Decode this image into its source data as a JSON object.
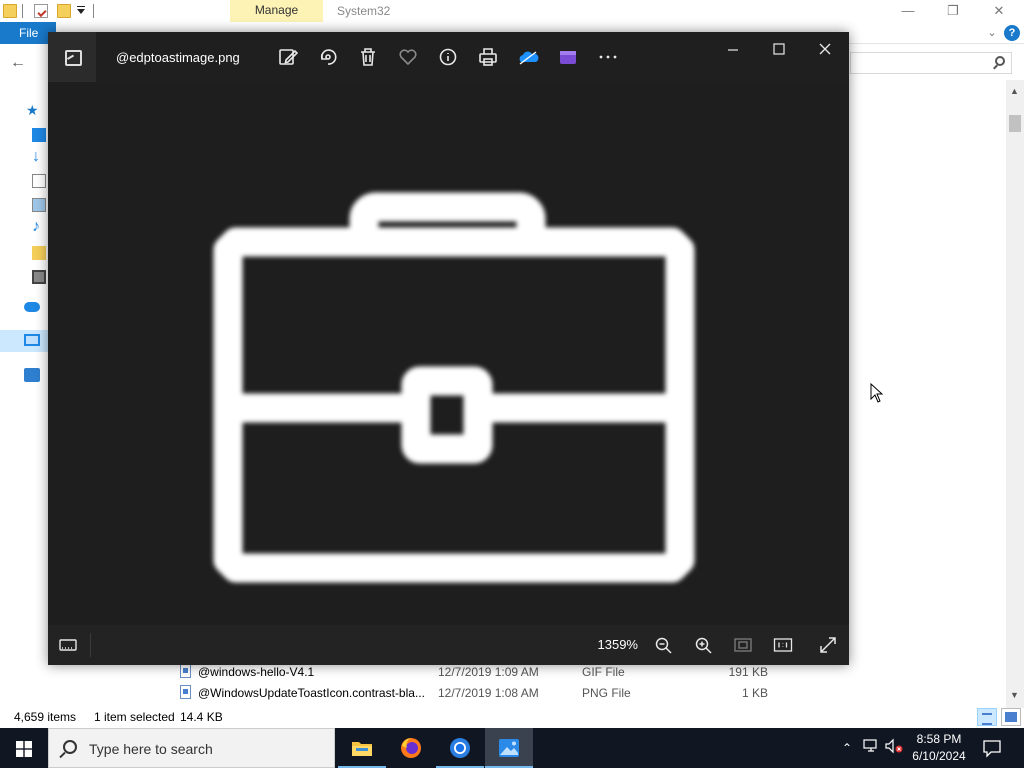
{
  "explorer": {
    "ribbon_context_tab": "Manage",
    "window_title": "System32",
    "file_tab": "File",
    "files": [
      {
        "name": "@windows-hello-V4.1",
        "date": "12/7/2019 1:09 AM",
        "type": "GIF File",
        "size": "191 KB"
      },
      {
        "name": "@WindowsUpdateToastIcon.contrast-bla...",
        "date": "12/7/2019 1:08 AM",
        "type": "PNG File",
        "size": "1 KB"
      }
    ],
    "status": {
      "item_count": "4,659 items",
      "selection": "1 item selected",
      "selection_size": "14.4 KB"
    }
  },
  "viewer": {
    "filename": "@edptoastimage.png",
    "zoom": "1359%",
    "toolbar_icons": [
      "edit-icon",
      "rotate-icon",
      "delete-icon",
      "favorite-icon",
      "info-icon",
      "print-icon",
      "onedrive-icon",
      "video-editor-icon",
      "more-icon"
    ]
  },
  "taskbar": {
    "search_placeholder": "Type here to search",
    "time": "8:58 PM",
    "date": "6/10/2024"
  },
  "colors": {
    "explorer_accent": "#1979ca",
    "manage_tab": "#fcf3b5",
    "viewer_bg": "#1e1e1e",
    "taskbar_bg": "#101622"
  }
}
